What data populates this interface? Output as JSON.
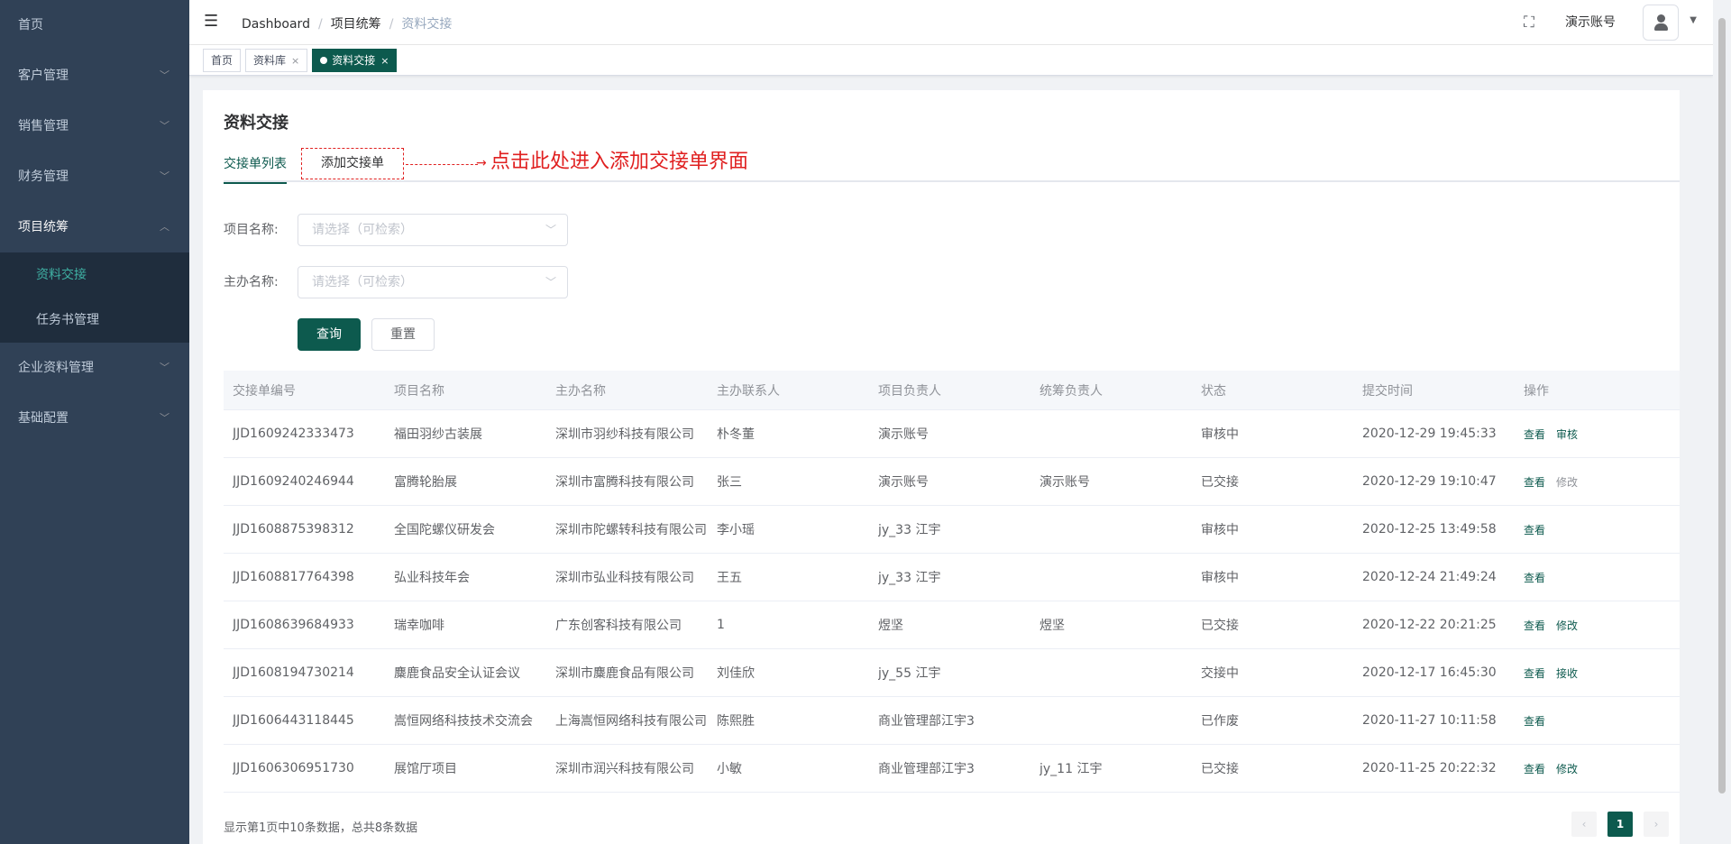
{
  "sidebar": {
    "items": [
      {
        "label": "首页",
        "has_arrow": false
      },
      {
        "label": "客户管理",
        "has_arrow": true
      },
      {
        "label": "销售管理",
        "has_arrow": true
      },
      {
        "label": "财务管理",
        "has_arrow": true
      },
      {
        "label": "项目统筹",
        "has_arrow": true,
        "open": true
      },
      {
        "label": "企业资料管理",
        "has_arrow": true
      },
      {
        "label": "基础配置",
        "has_arrow": true
      }
    ],
    "submenu": [
      {
        "label": "资料交接",
        "active": true
      },
      {
        "label": "任务书管理",
        "active": false
      }
    ]
  },
  "navbar": {
    "breadcrumb": [
      "Dashboard",
      "项目统筹",
      "资料交接"
    ],
    "user_name": "演示账号"
  },
  "tags": [
    {
      "label": "首页",
      "closable": false,
      "active": false
    },
    {
      "label": "资料库",
      "closable": true,
      "active": false
    },
    {
      "label": "资料交接",
      "closable": true,
      "active": true
    }
  ],
  "page": {
    "title": "资料交接",
    "tabs": [
      "交接单列表",
      "添加交接单"
    ],
    "callout": "点击此处进入添加交接单界面"
  },
  "filters": {
    "project": {
      "label": "项目名称:",
      "placeholder": "请选择（可检索）"
    },
    "host": {
      "label": "主办名称:",
      "placeholder": "请选择（可检索）"
    },
    "query_label": "查询",
    "reset_label": "重置"
  },
  "table": {
    "columns": [
      "交接单编号",
      "项目名称",
      "主办名称",
      "主办联系人",
      "项目负责人",
      "统筹负责人",
      "状态",
      "提交时间",
      "操作"
    ],
    "rows": [
      {
        "id": "JJD1609242333473",
        "project": "福田羽纱古装展",
        "host": "深圳市羽纱科技有限公司",
        "contact": "朴冬董",
        "pm": "演示账号",
        "coord": "",
        "status": "审核中",
        "time": "2020-12-29 19:45:33",
        "ops": [
          {
            "label": "查看",
            "muted": false
          },
          {
            "label": "审核",
            "muted": false
          }
        ]
      },
      {
        "id": "JJD1609240246944",
        "project": "富腾轮胎展",
        "host": "深圳市富腾科技有限公司",
        "contact": "张三",
        "pm": "演示账号",
        "coord": "演示账号",
        "status": "已交接",
        "time": "2020-12-29 19:10:47",
        "ops": [
          {
            "label": "查看",
            "muted": false
          },
          {
            "label": "修改",
            "muted": true
          }
        ]
      },
      {
        "id": "JJD1608875398312",
        "project": "全国陀螺仪研发会",
        "host": "深圳市陀螺转科技有限公司",
        "contact": "李小瑶",
        "pm": "jy_33 江宇",
        "coord": "",
        "status": "审核中",
        "time": "2020-12-25 13:49:58",
        "ops": [
          {
            "label": "查看",
            "muted": false
          }
        ]
      },
      {
        "id": "JJD1608817764398",
        "project": "弘业科技年会",
        "host": "深圳市弘业科技有限公司",
        "contact": "王五",
        "pm": "jy_33 江宇",
        "coord": "",
        "status": "审核中",
        "time": "2020-12-24 21:49:24",
        "ops": [
          {
            "label": "查看",
            "muted": false
          }
        ]
      },
      {
        "id": "JJD1608639684933",
        "project": "瑞幸咖啡",
        "host": "广东创客科技有限公司",
        "contact": "1",
        "pm": "煜坚",
        "coord": "煜坚",
        "status": "已交接",
        "time": "2020-12-22 20:21:25",
        "ops": [
          {
            "label": "查看",
            "muted": false
          },
          {
            "label": "修改",
            "muted": false
          }
        ]
      },
      {
        "id": "JJD1608194730214",
        "project": "麋鹿食品安全认证会议",
        "host": "深圳市麋鹿食品有限公司",
        "contact": "刘佳欣",
        "pm": "jy_55 江宇",
        "coord": "",
        "status": "交接中",
        "time": "2020-12-17 16:45:30",
        "ops": [
          {
            "label": "查看",
            "muted": false
          },
          {
            "label": "接收",
            "muted": false
          }
        ]
      },
      {
        "id": "JJD1606443118445",
        "project": "嵩恒网络科技技术交流会",
        "host": "上海嵩恒网络科技有限公司",
        "contact": "陈熙胜",
        "pm": "商业管理部江宇3",
        "coord": "",
        "status": "已作废",
        "time": "2020-11-27 10:11:58",
        "ops": [
          {
            "label": "查看",
            "muted": false
          }
        ]
      },
      {
        "id": "JJD1606306951730",
        "project": "展馆厅项目",
        "host": "深圳市润兴科技有限公司",
        "contact": "小敏",
        "pm": "商业管理部江宇3",
        "coord": "jy_11 江宇",
        "status": "已交接",
        "time": "2020-11-25 20:22:32",
        "ops": [
          {
            "label": "查看",
            "muted": false
          },
          {
            "label": "修改",
            "muted": false
          }
        ]
      }
    ]
  },
  "footer": {
    "info": "显示第1页中10条数据，总共8条数据",
    "current_page": "1"
  },
  "colors": {
    "primary": "#0d5a4e",
    "sidebar_bg": "#304156",
    "callout": "#e02020"
  }
}
